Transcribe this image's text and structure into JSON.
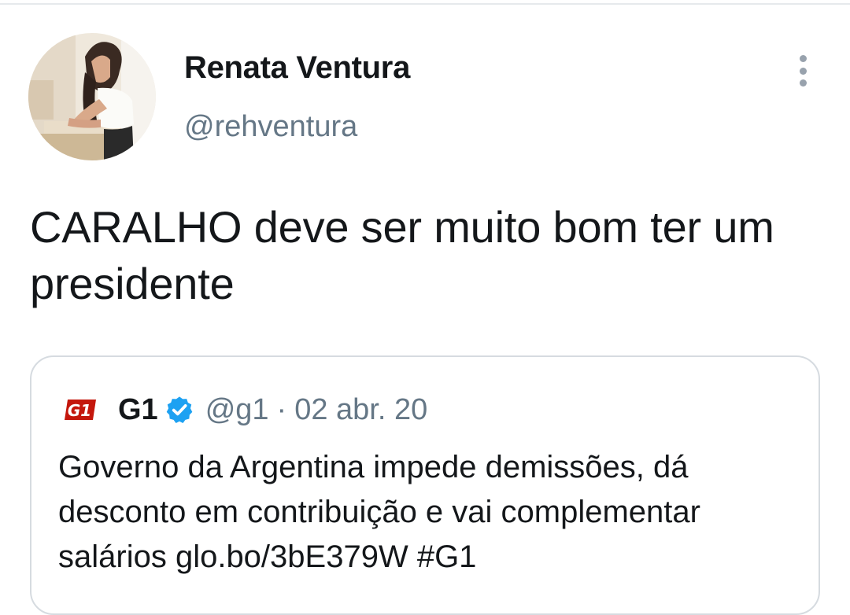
{
  "tweet": {
    "author_name": "Renata Ventura",
    "author_handle": "@rehventura",
    "text": "CARALHO deve ser muito bom ter um presidente"
  },
  "quoted_tweet": {
    "logo_text": "G1",
    "author_name": "G1",
    "verified": true,
    "author_handle": "@g1",
    "separator": "·",
    "date": "02 abr. 20",
    "text": "Governo da Argentina impede demissões, dá desconto em contribuição e vai complementar salários glo.bo/3bE379W #G1"
  },
  "icons": {
    "more": "more-vertical-icon",
    "verified": "verified-badge-icon",
    "logo": "g1-logo-icon"
  },
  "colors": {
    "text_primary": "#14171a",
    "text_secondary": "#657786",
    "verified_blue": "#1da1f2",
    "g1_red": "#c4170c",
    "card_border": "#d6dbe0"
  }
}
